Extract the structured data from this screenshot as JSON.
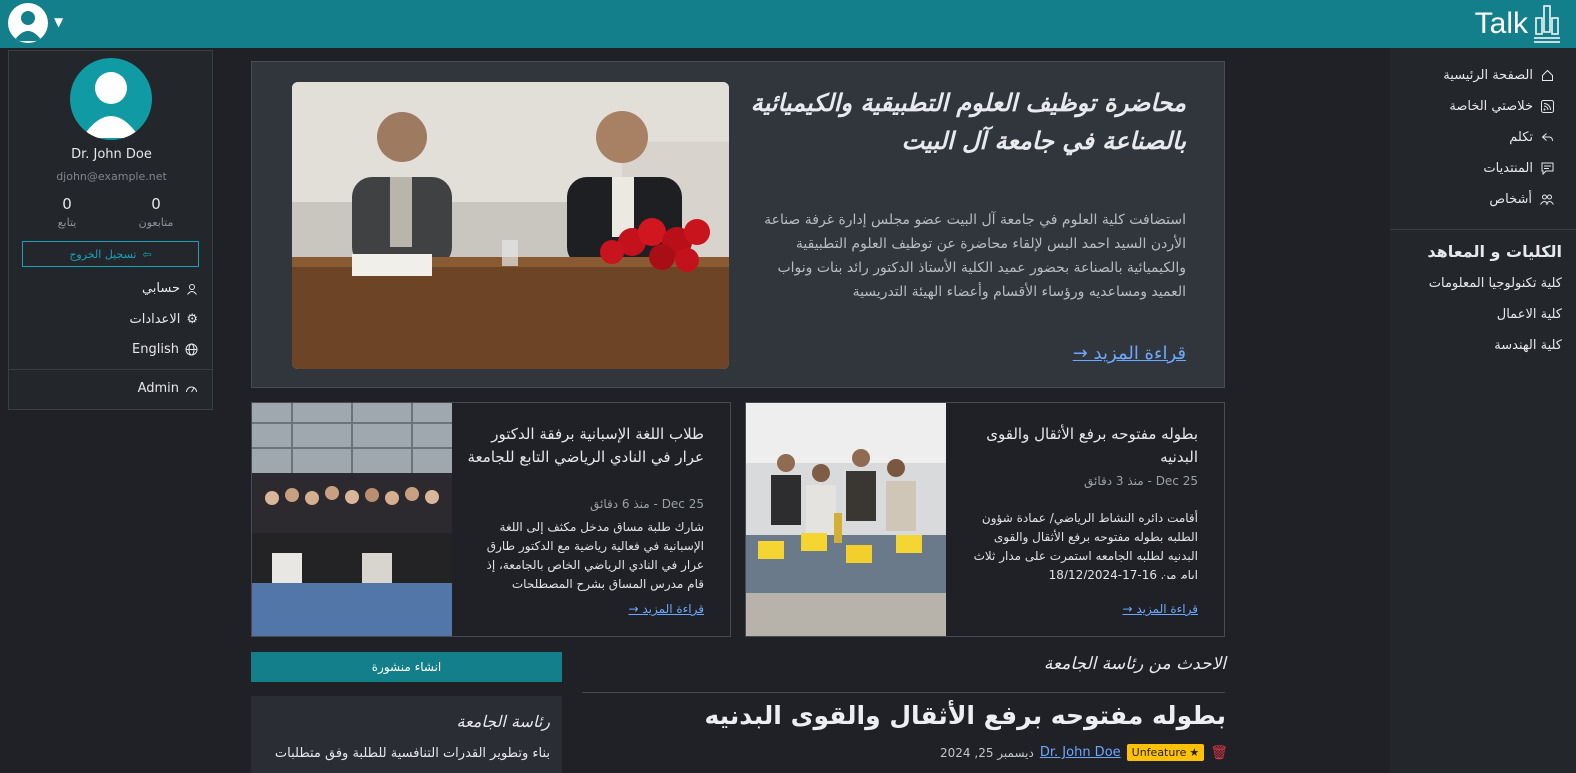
{
  "brand": {
    "name": "Talk"
  },
  "user": {
    "name": "Dr. John Doe",
    "email": "djohn@example.net",
    "following_count": "0",
    "following_label": "متابعون",
    "followers_count": "0",
    "followers_label": "يتابع",
    "logout_label": "تسجيل الخروج",
    "menu": {
      "account": "حسابي",
      "settings": "الاعدادات",
      "language": "English",
      "admin": "Admin"
    }
  },
  "nav": {
    "items": [
      "الصفحة الرئيسية",
      "خلاصتي الخاصة",
      "تكلم",
      "المنتديات",
      "أشخاص"
    ],
    "section_title": "الكليات و المعاهد",
    "colleges": [
      "كلية تكنولوجيا المعلومات",
      "كلية الاعمال",
      "كلية الهندسة"
    ]
  },
  "hero": {
    "title": "محاضرة توظيف العلوم التطبيقية والكيميائية بالصناعة في جامعة آل البيت",
    "body": "استضافت كلية العلوم في جامعة آل البيت عضو مجلس إدارة غرفة صناعة الأردن السيد احمد البس لإلقاء محاضرة عن توظيف العلوم التطبيقية والكيميائية بالصناعة بحضور عميد الكلية الأستاذ الدكتور رائد بنات ونواب العميد ومساعديه ورؤساء الأقسام وأعضاء الهيئة التدريسية",
    "read_more": "قراءة المزيد →"
  },
  "cards": [
    {
      "title": "بطوله مفتوحه برفع الأثقال والقوى البدنيه",
      "meta": "Dec 25 - منذ 3 دقائق",
      "body": "أقامت دائره النشاط الرياضي/ عمادة شؤون الطلبه بطوله مفتوحه برفع الأثقال والقوى البدنيه لطلبه الجامعه استمرت على مدار ثلاث ايام من 16-17-18/12/2024",
      "read_more": "قراءة المزيد →"
    },
    {
      "title": "طلاب اللغة الإسبانية برفقة الدكتور عرار في النادي الرياضي التابع للجامعة",
      "meta": "Dec 25 - منذ 6 دقائق",
      "body": "شارك طلبة مساق مدخل مكثف إلى اللغة الإسبانية في فعالية رياضية مع الدكتور طارق عرار في النادي الرياضي الخاص بالجامعة، إذ قام مدرس المساق بشرح المصطلحات",
      "read_more": "قراءة المزيد →"
    }
  ],
  "create_post": "انشاء منشورة",
  "presidency": {
    "title": "رئاسة الجامعة",
    "text": "بناء وتطوير القدرات التنافسية للطلبة وفق متطلبات"
  },
  "latest": {
    "heading": "الاحدث من رئاسة الجامعة",
    "title": "بطوله مفتوحه برفع الأثقال والقوى البدنيه",
    "badge": "Unfeature",
    "author": "Dr. John Doe",
    "date": "ديسمبر 25, 2024"
  },
  "colors": {
    "topbar": "#137f8a",
    "link": "#6ea8fe",
    "badge": "#ffc107",
    "danger": "#dc3545"
  }
}
